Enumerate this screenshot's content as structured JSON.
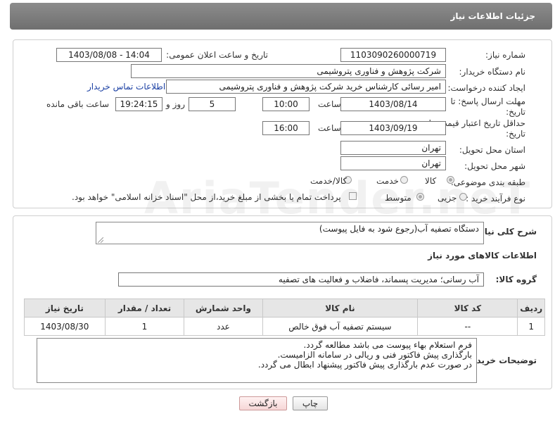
{
  "header": {
    "title": "جزئیات اطلاعات نیاز"
  },
  "watermark": "AriaTender.neT",
  "form": {
    "need_number_label": "شماره نیاز:",
    "need_number": "1103090260000719",
    "announce_label": "تاریخ و ساعت اعلان عمومی:",
    "announce_value": "1403/08/08 - 14:04",
    "buyer_org_label": "نام دستگاه خریدار:",
    "buyer_org": "شرکت پژوهش و فناوری پتروشیمی",
    "creator_label": "ایجاد کننده درخواست:",
    "creator": "امیر رسائی کارشناس خرید شرکت پژوهش و فناوری پتروشیمی",
    "contact_link": "اطلاعات تماس خریدار",
    "deadline_label": "مهلت ارسال پاسخ: تا تاریخ:",
    "deadline_date": "1403/08/14",
    "time_label": "ساعت",
    "deadline_time": "10:00",
    "days_value": "5",
    "days_label": "روز و",
    "remaining_time": "19:24:15",
    "remaining_label": "ساعت باقی مانده",
    "validity_label": "حداقل تاریخ اعتبار قیمت: تا تاریخ:",
    "validity_date": "1403/09/19",
    "validity_time": "16:00",
    "province_label": "استان محل تحویل:",
    "province": "تهران",
    "city_label": "شهر محل تحویل:",
    "city": "تهران",
    "category_label": "طبقه بندی موضوعی:",
    "category_options": [
      "کالا",
      "خدمت",
      "کالا/خدمت"
    ],
    "process_label": "نوع فرآیند خرید :",
    "process_options": [
      "جزیی",
      "متوسط"
    ],
    "payment_note": "پرداخت تمام یا بخشی از مبلغ خرید،از محل \"اسناد خزانه اسلامی\" خواهد بود."
  },
  "details": {
    "summary_label": "شرح کلی نیاز:",
    "summary": "دستگاه تصفیه آب(رجوع شود به فایل پیوست)",
    "goods_info_title": "اطلاعات کالاهای مورد نیاز",
    "goods_group_label": "گروه کالا:",
    "goods_group": "آب رسانی؛ مدیریت پسماند، فاضلاب و فعالیت های تصفیه",
    "table": {
      "headers": [
        "ردیف",
        "کد کالا",
        "نام کالا",
        "واحد شمارش",
        "تعداد / مقدار",
        "تاریخ نیاز"
      ],
      "rows": [
        [
          "1",
          "--",
          "سیستم تصفیه آب فوق خالص",
          "عدد",
          "1",
          "1403/08/30"
        ]
      ]
    },
    "buyer_notes_label": "توضیحات خریدار:",
    "buyer_notes": [
      "فرم استعلام بهاء پیوست می باشد مطالعه گردد.",
      "بارگذاری پیش فاکتور فنی و ریالی در سامانه الزامیست.",
      "در صورت عدم بارگذاری پیش فاکتور پیشنهاد ابطال می گردد."
    ]
  },
  "buttons": {
    "print": "چاپ",
    "back": "بازگشت"
  }
}
